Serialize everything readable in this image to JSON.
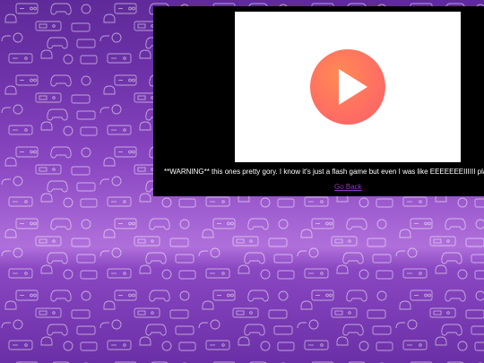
{
  "game": {
    "play_icon": "play-icon",
    "play_color": "#ff7a5c"
  },
  "warning_text": "**WARNING** this ones pretty gory. I know it's just a flash game but even I was like EEEEEEEIIIIII playing it",
  "go_back_label": "Go Back",
  "colors": {
    "background": "#7a3ab0",
    "panel": "#000000",
    "link": "#8a3ac8"
  }
}
